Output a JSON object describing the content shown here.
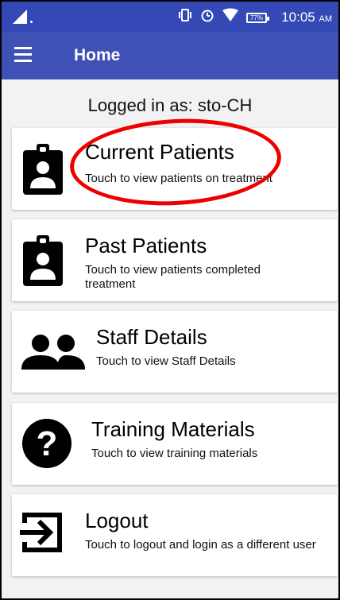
{
  "status_bar": {
    "time": "10:05",
    "ampm": "AM",
    "battery": "77%",
    "icons": [
      "signal-icon",
      "vibrate-icon",
      "alarm-icon",
      "wifi-icon",
      "battery-icon"
    ]
  },
  "app_bar": {
    "title": "Home",
    "menu_icon": "menu-icon",
    "color": "#3f51b5"
  },
  "logged_in": "Logged in as: sto-CH",
  "cards": [
    {
      "title": "Current Patients",
      "subtitle": "Touch to view patients on treatment",
      "icon": "patient-badge-icon"
    },
    {
      "title": "Past Patients",
      "subtitle": "Touch to view patients completed treatment",
      "icon": "patient-badge-icon"
    },
    {
      "title": "Staff Details",
      "subtitle": "Touch to view Staff Details",
      "icon": "people-icon"
    },
    {
      "title": "Training Materials",
      "subtitle": "Touch to view training materials",
      "icon": "help-icon"
    },
    {
      "title": "Logout",
      "subtitle": "Touch to logout and login as a different user",
      "icon": "logout-icon"
    }
  ],
  "annotation": {
    "type": "red-ellipse",
    "target": "Current Patients",
    "color": "#e00000"
  }
}
